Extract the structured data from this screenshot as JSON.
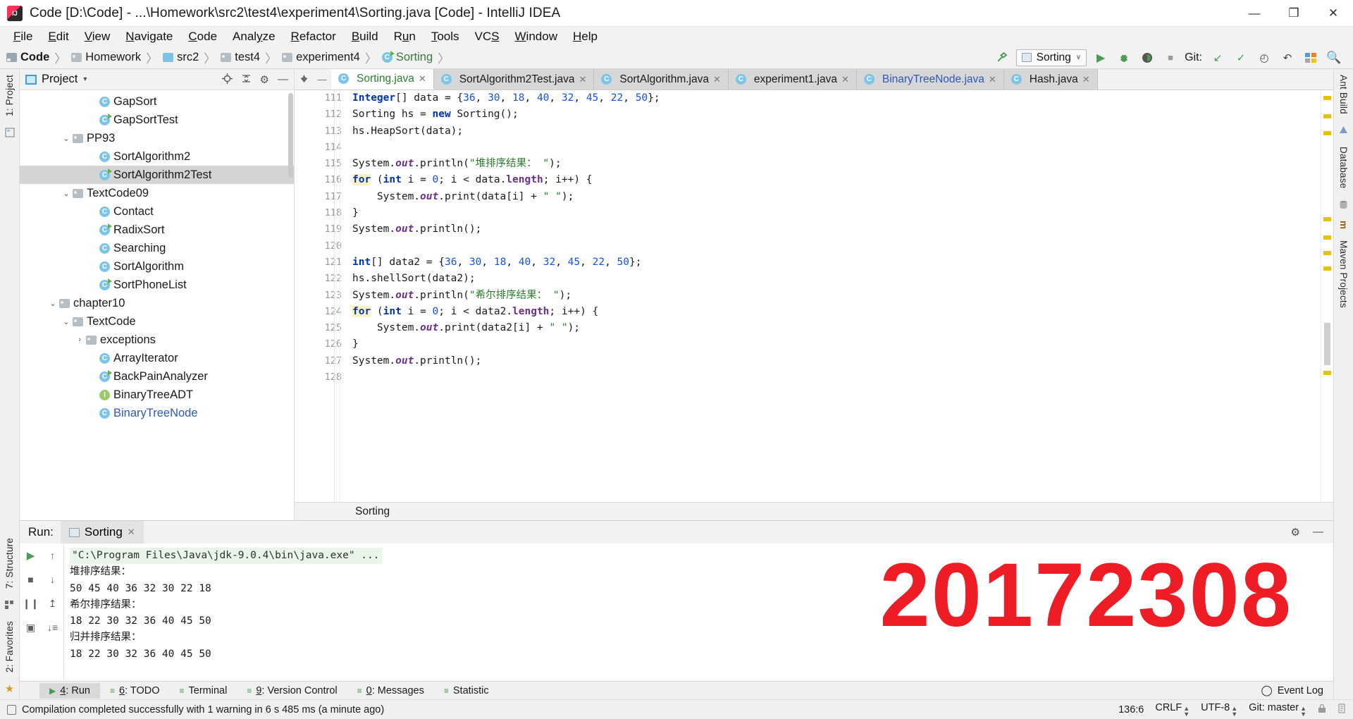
{
  "window": {
    "title": "Code [D:\\Code] - ...\\Homework\\src2\\test4\\experiment4\\Sorting.java [Code] - IntelliJ IDEA",
    "icon": "intellij-logo",
    "minimize": "—",
    "maximize": "❐",
    "close": "✕"
  },
  "menu": [
    "File",
    "Edit",
    "View",
    "Navigate",
    "Code",
    "Analyze",
    "Refactor",
    "Build",
    "Run",
    "Tools",
    "VCS",
    "Window",
    "Help"
  ],
  "breadcrumbs": [
    {
      "label": "Code",
      "icon": "module-icon",
      "bold": true
    },
    {
      "label": "Homework",
      "icon": "folder-icon"
    },
    {
      "label": "src2",
      "icon": "source-folder-icon"
    },
    {
      "label": "test4",
      "icon": "package-icon"
    },
    {
      "label": "experiment4",
      "icon": "package-icon"
    },
    {
      "label": "Sorting",
      "icon": "java-class-runnable-icon",
      "green": true
    }
  ],
  "toolbar": {
    "build_icon": "hammer-icon",
    "run_config": "Sorting",
    "run_config_caret": "∨",
    "run_icon": "▶",
    "debug_icon": "debug-bug-icon",
    "coverage_icon": "run-with-coverage-icon",
    "stop_icon": "■",
    "git_label": "Git:",
    "git_update_icon": "↙",
    "git_commit_icon": "✓",
    "git_history_icon": "◴",
    "git_revert_icon": "↶",
    "layout_icon": "layout-icon",
    "search_icon": "🔍"
  },
  "project_panel": {
    "title": "Project",
    "caret": "▾",
    "locate_icon": "locate-icon",
    "collapse_icon": "collapse-all-icon",
    "settings_icon": "⚙",
    "hide_icon": "—",
    "tree": [
      {
        "label": "GapSort",
        "indent": 5,
        "icon": "class-icon",
        "twisty": ""
      },
      {
        "label": "GapSortTest",
        "indent": 5,
        "icon": "class-runnable-icon",
        "twisty": ""
      },
      {
        "label": "PP93",
        "indent": 3,
        "icon": "package-icon",
        "twisty": "⌄"
      },
      {
        "label": "SortAlgorithm2",
        "indent": 5,
        "icon": "class-icon",
        "twisty": ""
      },
      {
        "label": "SortAlgorithm2Test",
        "indent": 5,
        "icon": "class-runnable-icon",
        "twisty": "",
        "selected": true
      },
      {
        "label": "TextCode09",
        "indent": 3,
        "icon": "package-icon",
        "twisty": "⌄"
      },
      {
        "label": "Contact",
        "indent": 5,
        "icon": "class-icon",
        "twisty": ""
      },
      {
        "label": "RadixSort",
        "indent": 5,
        "icon": "class-runnable-icon",
        "twisty": ""
      },
      {
        "label": "Searching",
        "indent": 5,
        "icon": "class-icon",
        "twisty": ""
      },
      {
        "label": "SortAlgorithm",
        "indent": 5,
        "icon": "class-icon",
        "twisty": ""
      },
      {
        "label": "SortPhoneList",
        "indent": 5,
        "icon": "class-runnable-icon",
        "twisty": ""
      },
      {
        "label": "chapter10",
        "indent": 2,
        "icon": "package-icon",
        "twisty": "⌄"
      },
      {
        "label": "TextCode",
        "indent": 3,
        "icon": "package-icon",
        "twisty": "⌄"
      },
      {
        "label": "exceptions",
        "indent": 4,
        "icon": "package-icon",
        "twisty": "›"
      },
      {
        "label": "ArrayIterator",
        "indent": 5,
        "icon": "class-icon",
        "twisty": ""
      },
      {
        "label": "BackPainAnalyzer",
        "indent": 5,
        "icon": "class-runnable-icon",
        "twisty": ""
      },
      {
        "label": "BinaryTreeADT",
        "indent": 5,
        "icon": "interface-icon",
        "twisty": ""
      },
      {
        "label": "BinaryTreeNode",
        "indent": 5,
        "icon": "class-icon",
        "twisty": "",
        "blue": true
      }
    ]
  },
  "editor": {
    "lead_icons": [
      "pin-icon",
      "hide-icon"
    ],
    "tabs": [
      {
        "label": "Sorting.java",
        "icon": "java-class-icon",
        "active": true,
        "close": "✕"
      },
      {
        "label": "SortAlgorithm2Test.java",
        "icon": "java-class-icon",
        "close": "✕"
      },
      {
        "label": "SortAlgorithm.java",
        "icon": "java-class-icon",
        "close": "✕"
      },
      {
        "label": "experiment1.java",
        "icon": "java-class-icon",
        "close": "✕"
      },
      {
        "label": "BinaryTreeNode.java",
        "icon": "java-class-icon",
        "close": "✕",
        "blue": true
      },
      {
        "label": "Hash.java",
        "icon": "java-class-icon",
        "close": "✕"
      }
    ],
    "first_line_number": 111,
    "line_numbers": [
      111,
      112,
      113,
      114,
      115,
      116,
      117,
      118,
      119,
      120,
      121,
      122,
      123,
      124,
      125,
      126,
      127,
      128
    ],
    "lines": [
      {
        "n": 111,
        "html": "<span class=\"kw\">Integer</span>[] data = {<span class=\"num\">36</span>, <span class=\"num\">30</span>, <span class=\"num\">18</span>, <span class=\"num\">40</span>, <span class=\"num\">32</span>, <span class=\"num\">45</span>, <span class=\"num\">22</span>, <span class=\"num\">50</span>};"
      },
      {
        "n": 112,
        "html": "Sorting hs = <span class=\"kw\">new</span> Sorting();"
      },
      {
        "n": 113,
        "html": "hs.HeapSort(data);"
      },
      {
        "n": 114,
        "html": ""
      },
      {
        "n": 115,
        "html": "System.<span class=\"fld\">out</span>.println(<span class=\"str\">\"堆排序结果： \"</span>);"
      },
      {
        "n": 116,
        "html": "<span class=\"kwh\">for</span> (<span class=\"kw\">int</span> i = <span class=\"num\">0</span>; i &lt; data.<span class=\"mfld\">length</span>; i++) {"
      },
      {
        "n": 117,
        "html": "    System.<span class=\"fld\">out</span>.print(data[i] + <span class=\"str\">\" \"</span>);"
      },
      {
        "n": 118,
        "html": "}"
      },
      {
        "n": 119,
        "html": "System.<span class=\"fld\">out</span>.println();"
      },
      {
        "n": 120,
        "html": ""
      },
      {
        "n": 121,
        "html": "<span class=\"kw\">int</span>[] data2 = {<span class=\"num\">36</span>, <span class=\"num\">30</span>, <span class=\"num\">18</span>, <span class=\"num\">40</span>, <span class=\"num\">32</span>, <span class=\"num\">45</span>, <span class=\"num\">22</span>, <span class=\"num\">50</span>};"
      },
      {
        "n": 122,
        "html": "hs.shellSort(data2);"
      },
      {
        "n": 123,
        "html": "System.<span class=\"fld\">out</span>.println(<span class=\"str\">\"希尔排序结果： \"</span>);"
      },
      {
        "n": 124,
        "html": "<span class=\"kwh\">for</span> (<span class=\"kw\">int</span> i = <span class=\"num\">0</span>; i &lt; data2.<span class=\"mfld\">length</span>; i++) {"
      },
      {
        "n": 125,
        "html": "    System.<span class=\"fld\">out</span>.print(data2[i] + <span class=\"str\">\" \"</span>);"
      },
      {
        "n": 126,
        "html": "}"
      },
      {
        "n": 127,
        "html": "System.<span class=\"fld\">out</span>.println();"
      },
      {
        "n": 128,
        "html": ""
      }
    ],
    "status_breadcrumb": "Sorting"
  },
  "run_panel": {
    "label": "Run:",
    "tab": "Sorting",
    "tab_close": "✕",
    "settings_icon": "⚙",
    "hide_icon": "—",
    "side_buttons": [
      "▶",
      "■",
      "❙❙",
      "▣"
    ],
    "side_buttons2": [
      "↑",
      "↓",
      "↥",
      "↓≡"
    ],
    "output": [
      {
        "text": "\"C:\\Program Files\\Java\\jdk-9.0.4\\bin\\java.exe\" ...",
        "style": "cmd"
      },
      {
        "text": "堆排序结果：",
        "style": "plain"
      },
      {
        "text": "50 45 40 36 32 30 22 18",
        "style": "plain"
      },
      {
        "text": "希尔排序结果：",
        "style": "plain"
      },
      {
        "text": "18 22 30 32 36 40 45 50",
        "style": "plain"
      },
      {
        "text": "归并排序结果：",
        "style": "plain"
      },
      {
        "text": "18 22 30 32 36 40 45 50",
        "style": "plain"
      }
    ],
    "watermark": "20172308",
    "watermark_color": "#ee1c25"
  },
  "tool_window_bar": {
    "left_items": [
      {
        "label": "4: Run",
        "icon": "▶",
        "active": true,
        "underline": "4"
      },
      {
        "label": "6: TODO",
        "icon": "todo-icon",
        "underline": "6"
      },
      {
        "label": "Terminal",
        "icon": "terminal-icon",
        "underline": ""
      },
      {
        "label": "9: Version Control",
        "icon": "vcs-icon",
        "underline": "9"
      },
      {
        "label": "0: Messages",
        "icon": "messages-icon",
        "underline": "0"
      },
      {
        "label": "Statistic",
        "icon": "statistic-icon",
        "underline": ""
      }
    ],
    "right_items": [
      {
        "label": "Event Log",
        "icon": "event-log-icon"
      }
    ]
  },
  "status_bar": {
    "icon": "memory-icon",
    "message": "Compilation completed successfully with 1 warning in 6 s 485 ms (a minute ago)",
    "caret_position": "136:6",
    "line_separator": "CRLF",
    "encoding": "UTF-8",
    "branch": "Git: master",
    "lock_icon": "lock-icon",
    "inspect_icon": "inspection-icon"
  },
  "left_rail": {
    "tabs": [
      "1: Project",
      "7: Structure",
      "2: Favorites"
    ],
    "icons": [
      "▤",
      "▦",
      "★"
    ]
  },
  "right_rail": {
    "tabs": [
      "Ant Build",
      "Database",
      "Maven Projects"
    ],
    "icons": [
      "▲",
      "▤",
      "m"
    ]
  }
}
